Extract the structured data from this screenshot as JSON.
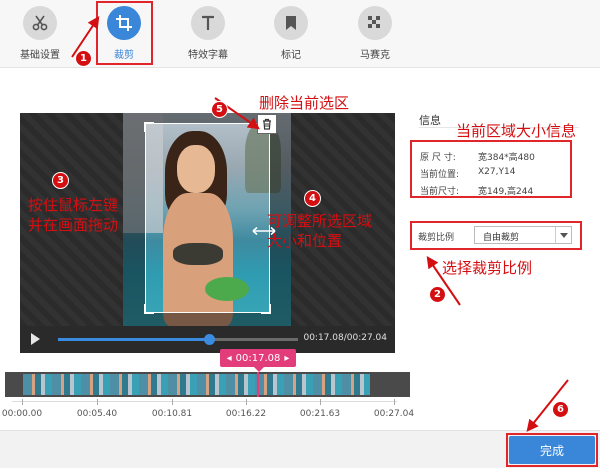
{
  "toolbar": {
    "tools": [
      {
        "label": "基础设置",
        "icon": "scissors-icon"
      },
      {
        "label": "裁剪",
        "icon": "crop-icon",
        "active": true
      },
      {
        "label": "特效字幕",
        "icon": "text-icon"
      },
      {
        "label": "标记",
        "icon": "bookmark-icon"
      },
      {
        "label": "马赛克",
        "icon": "mosaic-icon"
      }
    ]
  },
  "player": {
    "current_time": "00:17.08",
    "total_time": "00:27.04",
    "time_display": "00:17.08/00:27.04",
    "progress": 0.63
  },
  "timeline": {
    "badge_time": "00:17.08",
    "ticks": [
      "00:00.00",
      "00:05.40",
      "00:10.81",
      "00:16.22",
      "00:21.63",
      "00:27.04"
    ]
  },
  "info_panel": {
    "title": "信息",
    "original_size_label": "原 尺 寸:",
    "original_size_value": "宽384*高480",
    "position_label": "当前位置:",
    "position_value": "X27,Y14",
    "current_size_label": "当前尺寸:",
    "current_size_value": "宽149,高244"
  },
  "crop_ratio": {
    "label": "裁剪比例",
    "selected": "自由裁剪"
  },
  "done_button": "完成",
  "annotations": {
    "delete_selection": "删除当前选区",
    "area_size_info": "当前区域大小信息",
    "drag_hint_line1": "按住鼠标左键",
    "drag_hint_line2": "并在画面拖动",
    "resize_hint_line1": "可调整所选区域",
    "resize_hint_line2": "大小和位置",
    "select_ratio": "选择裁剪比例",
    "steps": [
      "1",
      "2",
      "3",
      "4",
      "5",
      "6"
    ]
  },
  "colors": {
    "accent": "#3a86d8",
    "annotation": "#d40f12",
    "timeline_marker": "#e23c7a"
  }
}
